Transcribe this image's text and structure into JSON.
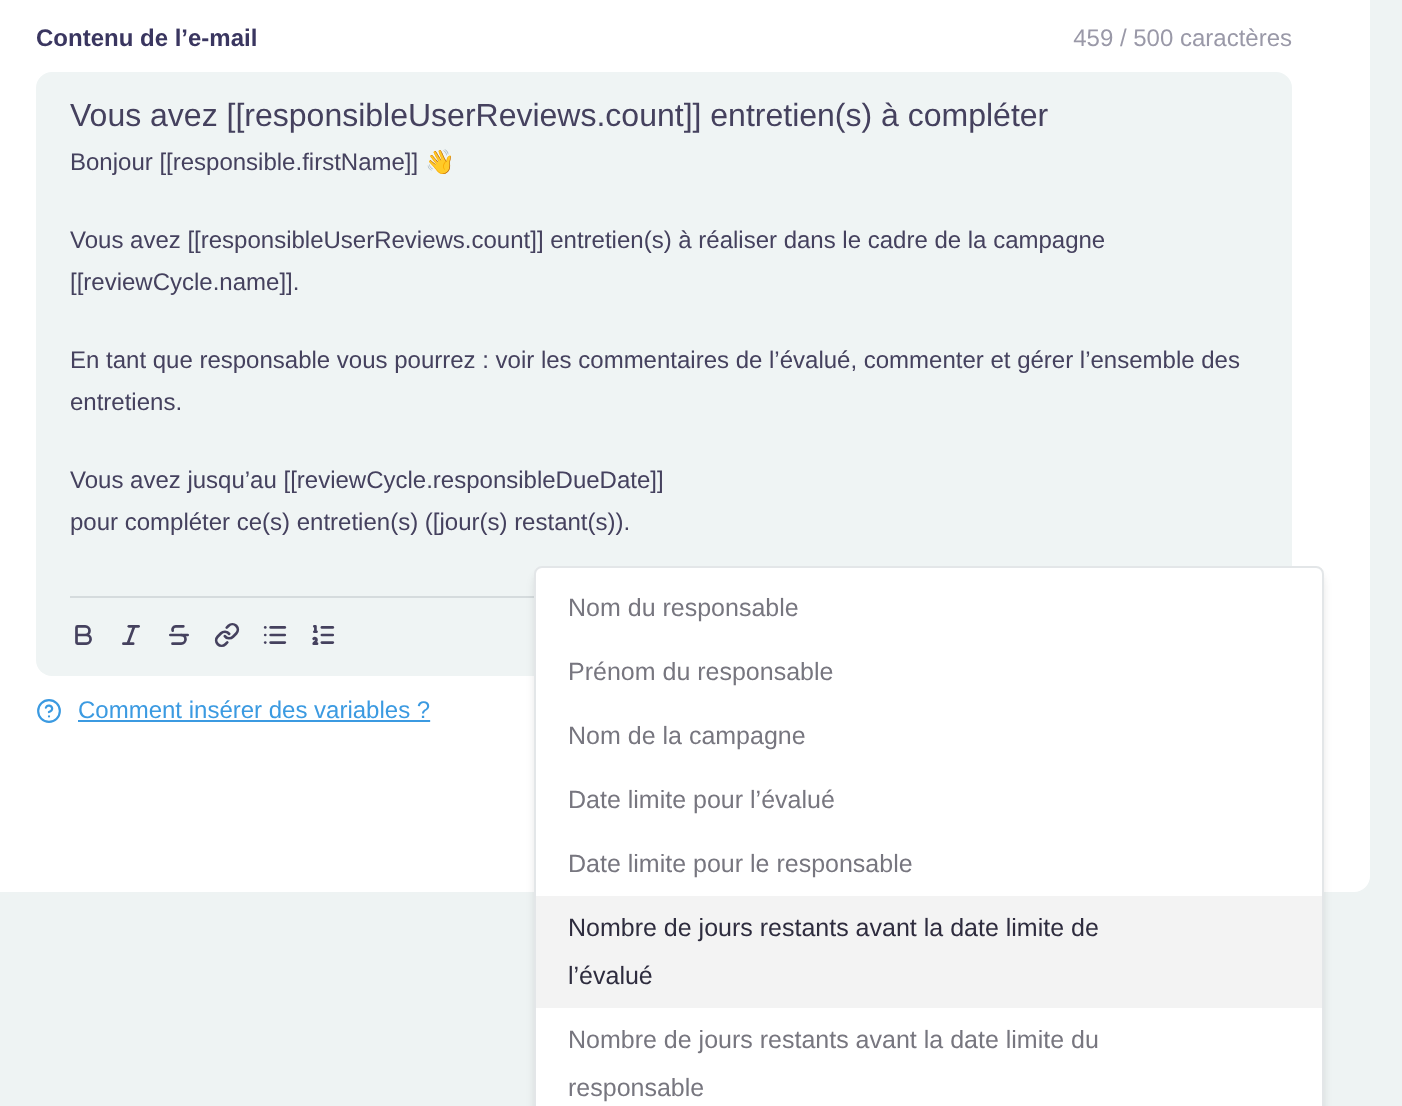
{
  "label": "Contenu de l’e-mail",
  "counter": "459 / 500 caractères",
  "editor": {
    "subject": "Vous avez [[responsibleUserReviews.count]] entretien(s) à compléter",
    "paragraphs": [
      [
        "Bonjour [[responsible.firstName]] 👋"
      ],
      [
        "Vous avez [[responsibleUserReviews.count]] entretien(s) à réaliser dans le cadre de la campagne [[reviewCycle.name]]."
      ],
      [
        "En tant que responsable vous pourrez : voir les commentaires de l’évalué, commenter et gérer l’ensemble des entretiens."
      ],
      [
        "Vous avez jusqu’au [[reviewCycle.responsibleDueDate]]",
        "pour compléter ce(s) entretien(s) ([jour(s) restant(s))."
      ]
    ],
    "toolbar": [
      {
        "kind": "bold"
      },
      {
        "kind": "italic"
      },
      {
        "kind": "strike"
      },
      {
        "kind": "link"
      },
      {
        "kind": "bullets"
      },
      {
        "kind": "numbers"
      }
    ]
  },
  "help_link": "Comment insérer des variables ?",
  "dropdown": [
    {
      "label": "Nom du responsable",
      "selected": false
    },
    {
      "label": "Prénom du responsable",
      "selected": false
    },
    {
      "label": "Nom de la campagne",
      "selected": false
    },
    {
      "label": "Date limite pour l’évalué",
      "selected": false
    },
    {
      "label": "Date limite pour le responsable",
      "selected": false
    },
    {
      "label": "Nombre de jours restants avant la date limite de l’évalué",
      "selected": true
    },
    {
      "label": "Nombre de jours restants avant la date limite du responsable",
      "selected": false
    }
  ]
}
